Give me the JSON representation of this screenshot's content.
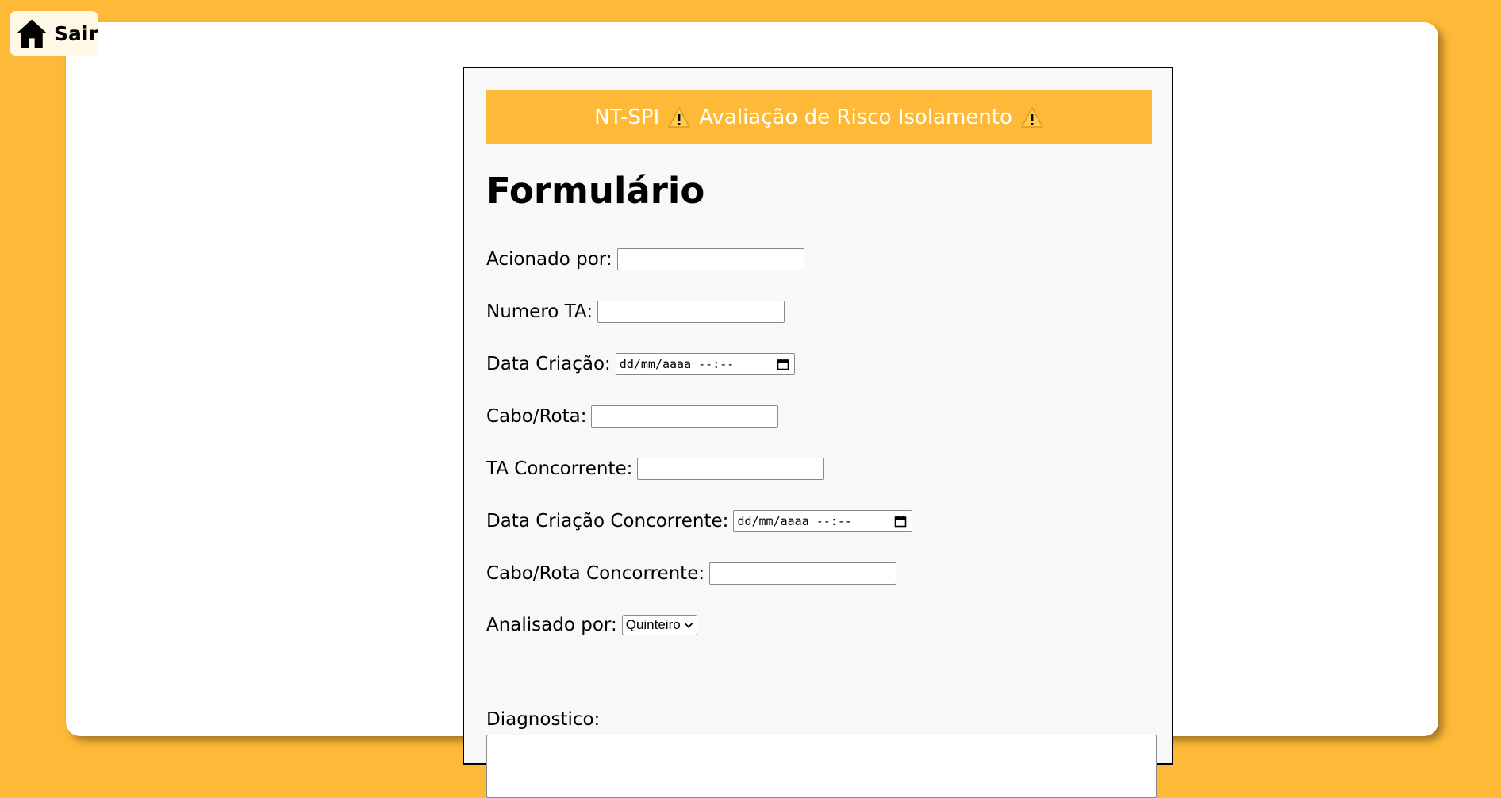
{
  "nav": {
    "home_label": "Sair"
  },
  "banner": {
    "left_text": "NT-SPI",
    "right_text": "Avaliação de Risco Isolamento"
  },
  "form": {
    "title": "Formulário",
    "fields": {
      "acionado_por": {
        "label": "Acionado por:",
        "value": ""
      },
      "numero_ta": {
        "label": "Numero TA:",
        "value": ""
      },
      "data_criacao": {
        "label": "Data Criação:",
        "placeholder": "dd/mm/aaaa --:--"
      },
      "cabo_rota": {
        "label": "Cabo/Rota:",
        "value": ""
      },
      "ta_concorrente": {
        "label": "TA Concorrente:",
        "value": ""
      },
      "data_criacao_concorrente": {
        "label": "Data Criação Concorrente:",
        "placeholder": "dd/mm/aaaa --:--"
      },
      "cabo_rota_concorrente": {
        "label": "Cabo/Rota Concorrente:",
        "value": ""
      },
      "analisado_por": {
        "label": "Analisado por:",
        "selected": "Quinteiro"
      },
      "diagnostico": {
        "label": "Diagnostico:",
        "value": ""
      }
    }
  },
  "colors": {
    "page_bg": "#ffb938",
    "banner_bg": "#ffb938",
    "card_bg": "#ffffff",
    "form_bg": "#f8f8f8"
  },
  "icons": {
    "home": "home-icon",
    "warning": "warning-icon",
    "calendar": "calendar-icon",
    "chevron": "chevron-down-icon"
  }
}
